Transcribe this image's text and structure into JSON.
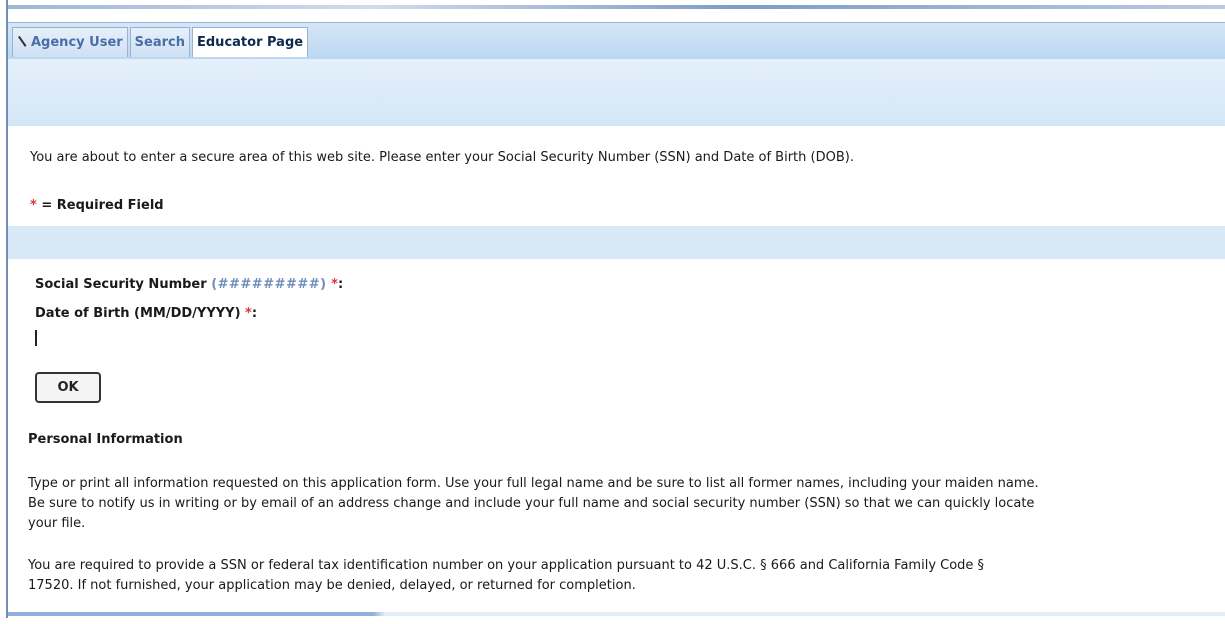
{
  "tabs": [
    {
      "label": "Agency User",
      "active": false
    },
    {
      "label": "Search",
      "active": false
    },
    {
      "label": "Educator Page",
      "active": true
    }
  ],
  "intro": "You are about to enter a secure area of this web site. Please enter your Social Security Number (SSN) and Date of Birth (DOB).",
  "required_legend": {
    "star": "*",
    "text": "= Required Field"
  },
  "ssn_field": {
    "label": "Social Security Number",
    "format": "(#########)",
    "star": "*",
    "colon": ":",
    "value": ""
  },
  "dob_field": {
    "label": "Date of Birth",
    "format": "(MM/DD/YYYY)",
    "star": "*",
    "colon": ":",
    "value": ""
  },
  "ok_button": "OK",
  "section_title": "Personal Information",
  "paragraph1": {
    "line1": "Type or print all information requested on this application form. Use your full legal name and be sure to list all former names, including your maiden name.",
    "line2": "Be sure to notify us in writing or by email of an address change and include your full name and social security number (SSN) so that we can quickly locate",
    "line3": "your file."
  },
  "paragraph2": {
    "line1": "You are required to provide a SSN or federal tax identification number on your application pursuant to 42 U.S.C. § 666 and California Family Code §",
    "line2": "17520. If not furnished, your application may be denied, delayed, or returned for completion."
  },
  "colors": {
    "tab_bar": "#bcd7f1",
    "band": "#d8e8f7",
    "required_star": "#d23a3a",
    "mask": "#6f8dbd"
  }
}
